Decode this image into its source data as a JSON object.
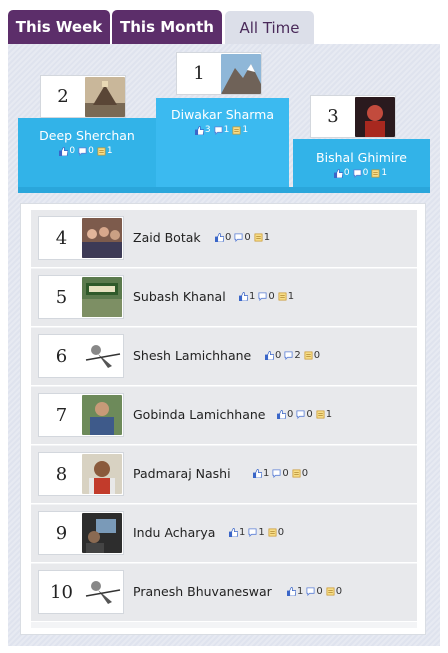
{
  "tabs": [
    {
      "label": "This Week",
      "active": false
    },
    {
      "label": "This Month",
      "active": false
    },
    {
      "label": "All Time",
      "active": true
    }
  ],
  "colors": {
    "tab_inactive": "#5c2e6a",
    "tab_active": "#dcdfe9",
    "podium": "#32b3e8",
    "like_icon": "#3a66c8",
    "comment_icon": "#5b7fd6",
    "post_icon": "#e3b23c"
  },
  "icons": {
    "likes": "thumbs-up-icon",
    "comments": "comment-bubble-icon",
    "posts": "note-icon"
  },
  "podium": [
    {
      "rank": "1",
      "name": "Diwakar Sharma",
      "likes": "3",
      "comments": "1",
      "posts": "1"
    },
    {
      "rank": "2",
      "name": "Deep Sherchan",
      "likes": "0",
      "comments": "0",
      "posts": "1"
    },
    {
      "rank": "3",
      "name": "Bishal Ghimire",
      "likes": "0",
      "comments": "0",
      "posts": "1"
    }
  ],
  "list": [
    {
      "rank": "4",
      "name": "Zaid Botak",
      "likes": "0",
      "comments": "0",
      "posts": "1"
    },
    {
      "rank": "5",
      "name": "Subash Khanal",
      "likes": "1",
      "comments": "0",
      "posts": "1"
    },
    {
      "rank": "6",
      "name": "Shesh Lamichhane",
      "likes": "0",
      "comments": "2",
      "posts": "0"
    },
    {
      "rank": "7",
      "name": "Gobinda Lamichhane",
      "likes": "0",
      "comments": "0",
      "posts": "1"
    },
    {
      "rank": "8",
      "name": "Padmaraj Nashi",
      "likes": "1",
      "comments": "0",
      "posts": "0"
    },
    {
      "rank": "9",
      "name": "Indu Acharya",
      "likes": "1",
      "comments": "1",
      "posts": "0"
    },
    {
      "rank": "10",
      "name": "Pranesh Bhuvaneswar",
      "likes": "1",
      "comments": "0",
      "posts": "0"
    }
  ]
}
